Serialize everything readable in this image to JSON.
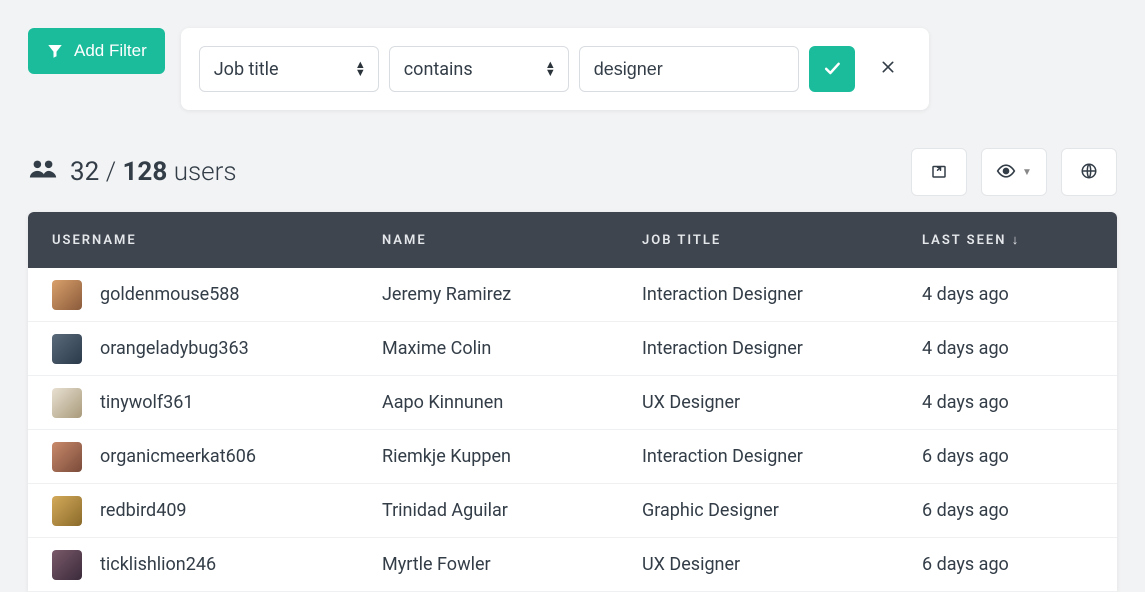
{
  "toolbar": {
    "add_filter_label": "Add Filter"
  },
  "filter": {
    "field": "Job title",
    "operator": "contains",
    "value": "designer"
  },
  "summary": {
    "filtered": "32",
    "separator": "/",
    "total": "128",
    "noun": "users"
  },
  "table": {
    "headers": {
      "username": "USERNAME",
      "name": "NAME",
      "job_title": "JOB TITLE",
      "last_seen": "LAST SEEN ↓"
    },
    "rows": [
      {
        "username": "goldenmouse588",
        "name": "Jeremy Ramirez",
        "job_title": "Interaction Designer",
        "last_seen": "4 days ago"
      },
      {
        "username": "orangeladybug363",
        "name": "Maxime Colin",
        "job_title": "Interaction Designer",
        "last_seen": "4 days ago"
      },
      {
        "username": "tinywolf361",
        "name": "Aapo Kinnunen",
        "job_title": "UX Designer",
        "last_seen": "4 days ago"
      },
      {
        "username": "organicmeerkat606",
        "name": "Riemkje Kuppen",
        "job_title": "Interaction Designer",
        "last_seen": "6 days ago"
      },
      {
        "username": "redbird409",
        "name": "Trinidad Aguilar",
        "job_title": "Graphic Designer",
        "last_seen": "6 days ago"
      },
      {
        "username": "ticklishlion246",
        "name": "Myrtle Fowler",
        "job_title": "UX Designer",
        "last_seen": "6 days ago"
      }
    ]
  }
}
